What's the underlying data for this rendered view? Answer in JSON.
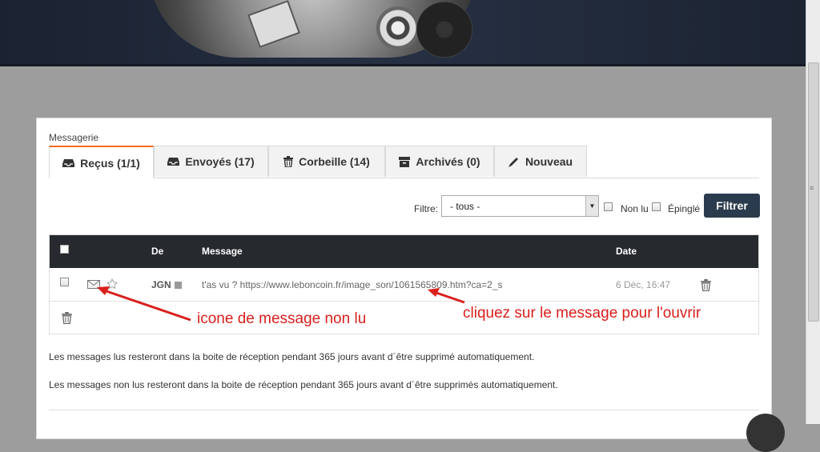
{
  "section_title": "Messagerie",
  "tabs": [
    {
      "label": "Reçus (1/1)",
      "icon": "inbox-icon",
      "active": true
    },
    {
      "label": "Envoyés (17)",
      "icon": "inbox-icon",
      "active": false
    },
    {
      "label": "Corbeille (14)",
      "icon": "trash-icon",
      "active": false
    },
    {
      "label": "Archivés (0)",
      "icon": "archive-icon",
      "active": false
    },
    {
      "label": "Nouveau",
      "icon": "pencil-icon",
      "active": false
    }
  ],
  "filter": {
    "label": "Filtre:",
    "selected": "- tous -",
    "unread_label": "Non lu",
    "pinned_label": "Épinglé",
    "button_label": "Filtrer"
  },
  "table": {
    "headers": {
      "from": "De",
      "message": "Message",
      "date": "Date"
    },
    "rows": [
      {
        "sender": "JGN",
        "message": "t'as vu ? https://www.leboncoin.fr/image_son/1061565809.htm?ca=2_s",
        "date": "6 Déc, 16:47",
        "unread": true
      }
    ]
  },
  "notes": {
    "read": "Les messages lus resteront dans la boite de réception pendant 365 jours avant d´être supprimé automatiquement.",
    "unread": "Les messages non lus resteront dans la boite de réception pendant 365 jours avant d´être supprimés automatiquement."
  },
  "annotations": {
    "unread_icon": "icone de message non lu",
    "click_message": "cliquez sur le message pour l'ouvrir",
    "color": "#d9201d"
  },
  "colors": {
    "accent_tab": "#f26d1b",
    "filter_button": "#2a3b4d",
    "table_header": "#262a2f"
  }
}
